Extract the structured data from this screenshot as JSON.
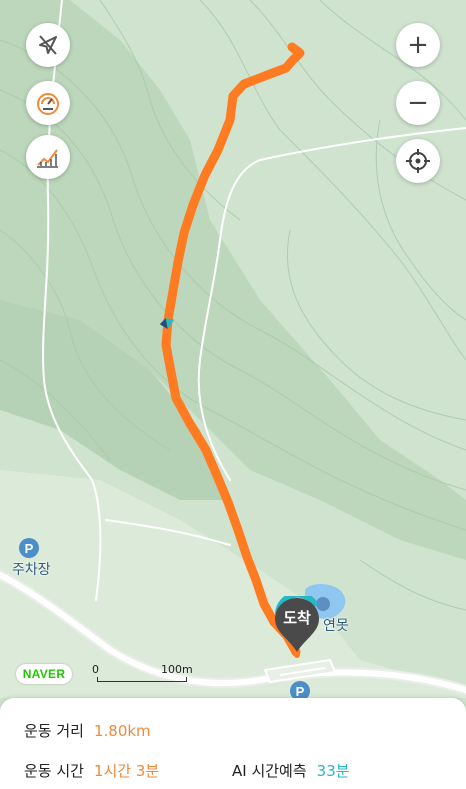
{
  "map": {
    "brand": "NAVER",
    "scale": {
      "zero": "0",
      "distance": "100m"
    },
    "places": {
      "parking": "주차장",
      "pond": "연못"
    },
    "destination": "도착",
    "colors": {
      "route": "#fe7b22",
      "terrain": "#cfe3cf",
      "naver": "#1ec800",
      "parking": "#4c8fc8",
      "pin": "#4a4a4a",
      "pin_ring": "#26b8c6"
    }
  },
  "controls": {
    "left": [
      "no-location-icon",
      "speedometer-icon",
      "elevation-icon"
    ],
    "right": [
      "zoom-in-icon",
      "zoom-out-icon",
      "locate-icon"
    ],
    "zoom_in_glyph": "+",
    "zoom_out_glyph": "−"
  },
  "stats": {
    "distance": {
      "label": "운동 거리",
      "value": "1.80km",
      "color": "#f08a3c"
    },
    "time": {
      "label": "운동 시간",
      "value": "1시간 3분",
      "color": "#f08a3c"
    },
    "ai": {
      "label": "AI 시간예측",
      "value": "33분",
      "color": "#2bb4c6"
    }
  }
}
